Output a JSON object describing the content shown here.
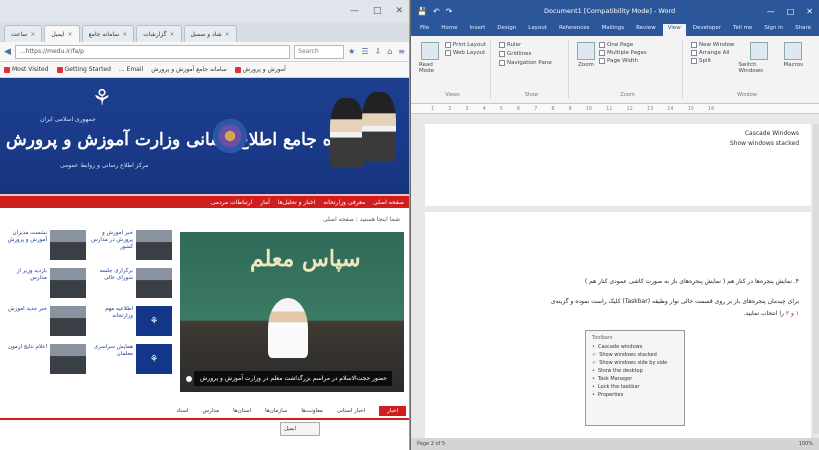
{
  "firefox": {
    "tabs": [
      {
        "label": "ساعت",
        "active": false
      },
      {
        "label": "ایمیل",
        "active": true
      },
      {
        "label": "سامانه جامع",
        "active": false
      },
      {
        "label": "گزارشات",
        "active": false
      },
      {
        "label": "شاد و سمبل",
        "active": false
      }
    ],
    "url": "...https://medu.ir/fa/p",
    "search_placeholder": "Search",
    "bookmarks": [
      "Most Visited",
      "Getting Started",
      "... Email",
      "سامانه جامع آموزش و پرورش",
      "آموزش و پرورش"
    ],
    "site": {
      "banner_small": "جمهوری اسلامی ایران",
      "banner_title": "پایگاه جامع اطلاع رسانی وزارت آموزش و پرورش",
      "banner_sub": "مرکز اطلاع رسانی و روابط عمومی",
      "menu": [
        "صفحه اصلی",
        "معرفی وزارتخانه",
        "اخبار و تحلیل‌ها",
        "آمار",
        "ارتباطات مردمی"
      ],
      "breadcrumb": "شما اینجا هستید : صفحه اصلی",
      "hero_caption": "حضور حجت‌الاسلام در مراسم بزرگداشت معلم در وزارت آموزش و پرورش",
      "hero_callig": "سپاس معلم",
      "news": [
        {
          "text": "خبر آموزش و پرورش در مدارس کشور"
        },
        {
          "text": "نشست مدیران آموزش و پرورش"
        },
        {
          "text": "برگزاری جلسه شورای عالی"
        },
        {
          "text": "بازدید وزیر از مدارس"
        },
        {
          "text": "اطلاعیه مهم وزارتخانه"
        },
        {
          "text": "خبر جدید آموزش"
        },
        {
          "text": "همایش سراسری معلمان"
        },
        {
          "text": "اعلام نتایج آزمون"
        }
      ],
      "bottom_tabs": [
        "اخبار",
        "اخبار استانی",
        "معاونت‌ها",
        "سازمان‌ها",
        "استان‌ها",
        "مدارس",
        "اسناد"
      ],
      "popup": "ایمیل"
    }
  },
  "word": {
    "title": "Document1 [Compatibility Mode] - Word",
    "tabs": [
      "File",
      "Home",
      "Insert",
      "Design",
      "Layout",
      "References",
      "Mailings",
      "Review",
      "View",
      "Developer",
      "Tell me",
      "Sign in",
      "Share"
    ],
    "active_tab": "View",
    "ribbon": {
      "views": "Read Mode",
      "print_layout": "Print Layout",
      "web_layout": "Web Layout",
      "show_ruler": "Ruler",
      "show_grid": "Gridlines",
      "show_nav": "Navigation Pane",
      "zoom": "Zoom",
      "one_page": "One Page",
      "multi_page": "Multiple Pages",
      "page_width": "Page Width",
      "new_window": "New Window",
      "arrange_all": "Arrange All",
      "split": "Split",
      "switch_windows": "Switch Windows",
      "macros": "Macros",
      "group_views": "Views",
      "group_show": "Show",
      "group_zoom": "Zoom",
      "group_window": "Window"
    },
    "page1_lines": [
      "Cascade Windows",
      "Show windows stacked"
    ],
    "page2_lines": [
      "۴. نمایش پنجره‌ها در کنار هم ( نمایش پنجره‌های باز به صورت کاشی عمودی کنار هم )",
      "برای چیدمان پنجره‌های باز بر روی قسمت خالی نوار وظیفه (Taskbar) کلیک راست نموده و گزینه‌ی"
    ],
    "page2_line3": "را انتخاب نمایید.",
    "page2_red": "۱ و ۲",
    "context_menu": {
      "header": "Toolbars",
      "items": [
        {
          "label": "Cascade windows",
          "checked": false
        },
        {
          "label": "Show windows stacked",
          "checked": true
        },
        {
          "label": "Show windows side by side",
          "checked": true
        },
        {
          "label": "Show the desktop",
          "checked": false
        },
        {
          "label": "Task Manager",
          "checked": false
        },
        {
          "label": "Lock the taskbar",
          "checked": false
        },
        {
          "label": "Properties",
          "checked": false
        }
      ]
    },
    "status_left": "Page 2 of 5",
    "status_right": "100%"
  },
  "colors": {
    "word_blue": "#2b579a",
    "site_blue": "#1d3f8f",
    "site_red": "#d01e1e"
  }
}
